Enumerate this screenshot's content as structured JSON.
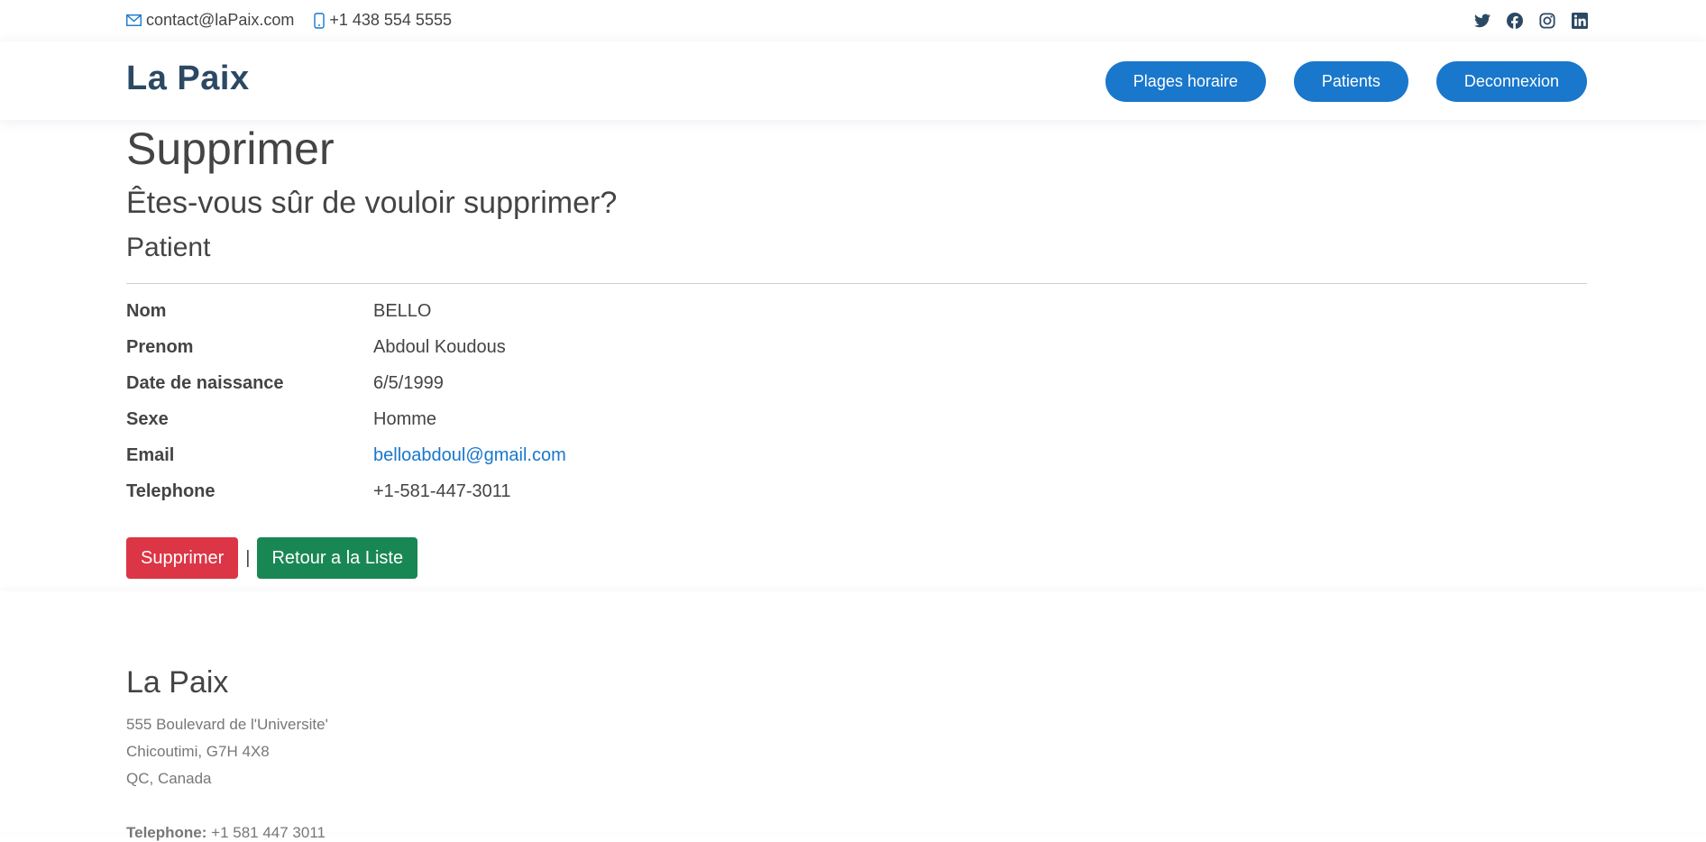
{
  "topbar": {
    "email": "contact@laPaix.com",
    "phone": "+1 438 554 5555",
    "social": [
      "twitter-icon",
      "facebook-icon",
      "instagram-icon",
      "linkedin-icon"
    ]
  },
  "header": {
    "logo": "La Paix",
    "nav": [
      "Plages horaire",
      "Patients",
      "Deconnexion"
    ]
  },
  "page": {
    "title": "Supprimer",
    "question": "Êtes-vous sûr de vouloir supprimer?",
    "entity": "Patient",
    "details": [
      {
        "label": "Nom",
        "value": "BELLO"
      },
      {
        "label": "Prenom",
        "value": "Abdoul Koudous"
      },
      {
        "label": "Date de naissance",
        "value": "6/5/1999"
      },
      {
        "label": "Sexe",
        "value": "Homme"
      },
      {
        "label": "Email",
        "value": "belloabdoul@gmail.com"
      },
      {
        "label": "Telephone",
        "value": "+1-581-447-3011"
      }
    ],
    "actions": {
      "delete": "Supprimer",
      "separator": "|",
      "back": "Retour a la Liste"
    }
  },
  "footer": {
    "name": "La Paix",
    "address_lines": [
      "555 Boulevard de l'Universite'",
      "Chicoutimi, G7H 4X8",
      "QC, Canada"
    ],
    "phone_label": "Telephone:",
    "phone": "+1 581 447 3011"
  },
  "colors": {
    "primary": "#1977cc",
    "logo": "#2c4964",
    "danger": "#dc3545",
    "success": "#198754"
  }
}
